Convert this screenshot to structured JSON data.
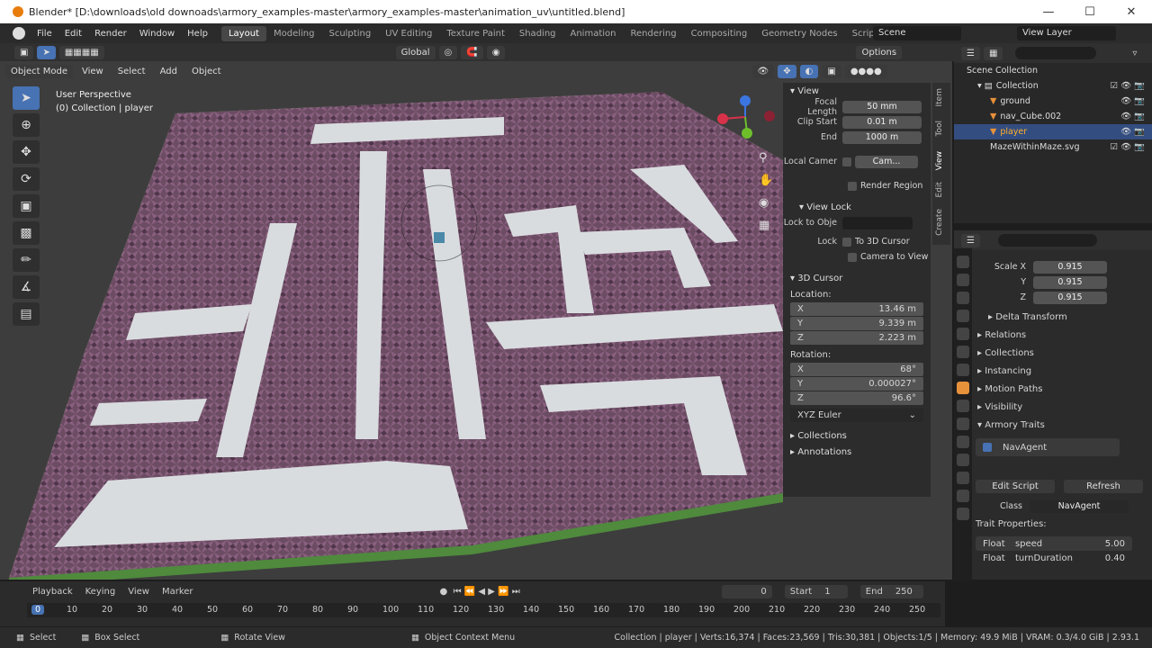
{
  "title": "Blender* [D:\\downloads\\old downoads\\armory_examples-master\\armory_examples-master\\animation_uv\\untitled.blend]",
  "menu": [
    "File",
    "Edit",
    "Render",
    "Window",
    "Help"
  ],
  "workspaces": [
    "Layout",
    "Modeling",
    "Sculpting",
    "UV Editing",
    "Texture Paint",
    "Shading",
    "Animation",
    "Rendering",
    "Compositing",
    "Geometry Nodes",
    "Scripting"
  ],
  "scene": "Scene",
  "view_layer": "View Layer",
  "options": "Options",
  "global": "Global",
  "viewport": {
    "mode": "Object Mode",
    "menus": [
      "View",
      "Select",
      "Add",
      "Object"
    ],
    "persp": "User Perspective",
    "collection": "(0) Collection | player"
  },
  "npanel": {
    "view": "View",
    "focal_label": "Focal Length",
    "focal": "50 mm",
    "clip_start_label": "Clip Start",
    "clip_start": "0.01 m",
    "end_label": "End",
    "clip_end": "1000 m",
    "local_cam": "Local Camer",
    "cam": "Cam...",
    "render_region": "Render Region",
    "view_lock": "View Lock",
    "lock_obj": "Lock to Obje",
    "lock": "Lock",
    "to_cursor": "To 3D Cursor",
    "cam_to_view": "Camera to View",
    "cursor": "3D Cursor",
    "location": "Location:",
    "x": "13.46 m",
    "y": "9.339 m",
    "z": "2.223 m",
    "rotation": "Rotation:",
    "rx": "68°",
    "ry": "0.000027°",
    "rz": "96.6°",
    "euler": "XYZ Euler",
    "collections": "Collections",
    "annotations": "Annotations",
    "tabs": [
      "Item",
      "Tool",
      "View",
      "Edit",
      "Create"
    ]
  },
  "outliner": {
    "scene_coll": "Scene Collection",
    "collection": "Collection",
    "items": [
      "ground",
      "nav_Cube.002",
      "player",
      "MazeWithinMaze.svg"
    ]
  },
  "props": {
    "scale_x": "0.915",
    "scale_y": "0.915",
    "scale_z": "0.915",
    "scale_label": "Scale X",
    "delta": "Delta Transform",
    "sections": [
      "Relations",
      "Collections",
      "Instancing",
      "Motion Paths",
      "Visibility",
      "Armory Traits"
    ],
    "trait": "NavAgent",
    "edit_script": "Edit Script",
    "refresh": "Refresh",
    "class_label": "Class",
    "class_val": "NavAgent",
    "trait_props": "Trait Properties:",
    "p1_type": "Float",
    "p1_name": "speed",
    "p1_val": "5.00",
    "p2_type": "Float",
    "p2_name": "turnDuration",
    "p2_val": "0.40"
  },
  "timeline": {
    "menus": [
      "Playback",
      "Keying",
      "View",
      "Marker"
    ],
    "frame": "0",
    "start_label": "Start",
    "start": "1",
    "end_label": "End",
    "end": "250",
    "ticks": [
      "0",
      "10",
      "20",
      "30",
      "40",
      "50",
      "60",
      "70",
      "80",
      "90",
      "100",
      "110",
      "120",
      "130",
      "140",
      "150",
      "160",
      "170",
      "180",
      "190",
      "200",
      "210",
      "220",
      "230",
      "240",
      "250"
    ]
  },
  "status": {
    "select": "Select",
    "box": "Box Select",
    "rotate": "Rotate View",
    "ctx": "Object Context Menu",
    "info": "Collection | player | Verts:16,374 | Faces:23,569 | Tris:30,381 | Objects:1/5 | Memory: 49.9 MiB | VRAM: 0.3/4.0 GiB | 2.93.1"
  }
}
